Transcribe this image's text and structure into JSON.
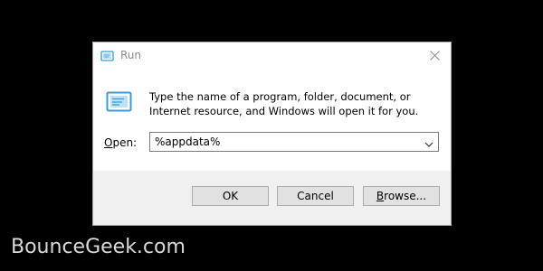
{
  "dialog": {
    "title": "Run",
    "description": "Type the name of a program, folder, document, or Internet resource, and Windows will open it for you.",
    "open_label_prefix": "",
    "open_label_accel": "O",
    "open_label_rest": "pen:",
    "open_value": "%appdata%",
    "buttons": {
      "ok": "OK",
      "cancel": "Cancel",
      "browse_accel": "B",
      "browse_rest": "rowse..."
    }
  },
  "watermark": "BounceGeek.com",
  "icons": {
    "title": "run-app-icon",
    "big": "run-app-icon",
    "close": "close-icon",
    "dropdown": "chevron-down-icon"
  },
  "colors": {
    "background": "#000000",
    "dialog": "#ffffff",
    "footer": "#f0f0f0",
    "button": "#e1e1e1",
    "icon_blue": "#3b9ad9"
  }
}
